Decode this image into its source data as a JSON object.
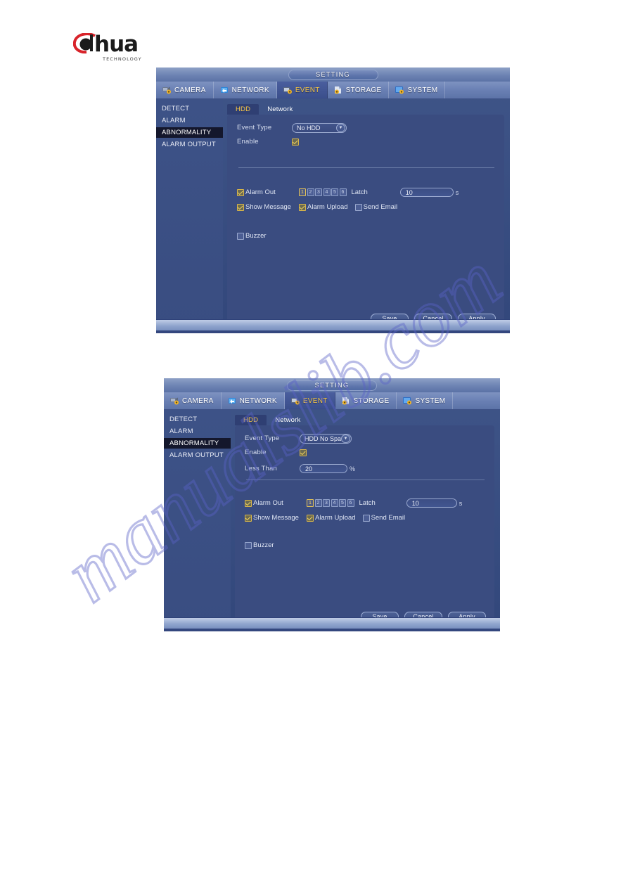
{
  "logo": {
    "brand": "a|hua",
    "brand_text": "hua",
    "sub": "TECHNOLOGY"
  },
  "watermark": {
    "text": "manualslib.com"
  },
  "dialogs": [
    {
      "title": "SETTING",
      "tabs": [
        {
          "label": "CAMERA",
          "icon": "camera-gear-icon",
          "active": false
        },
        {
          "label": "NETWORK",
          "icon": "network-icon",
          "active": false
        },
        {
          "label": "EVENT",
          "icon": "event-gear-icon",
          "active": true
        },
        {
          "label": "STORAGE",
          "icon": "storage-gear-icon",
          "active": false
        },
        {
          "label": "SYSTEM",
          "icon": "system-gear-icon",
          "active": false
        }
      ],
      "sidebar": [
        {
          "label": "DETECT",
          "active": false
        },
        {
          "label": "ALARM",
          "active": false
        },
        {
          "label": "ABNORMALITY",
          "active": true
        },
        {
          "label": "ALARM OUTPUT",
          "active": false
        }
      ],
      "subtabs": [
        {
          "label": "HDD",
          "active": true
        },
        {
          "label": "Network",
          "active": false
        }
      ],
      "form": {
        "event_type_label": "Event Type",
        "event_type_value": "No HDD",
        "enable_label": "Enable",
        "enable_checked": true,
        "less_than_label": "",
        "less_than_value": "",
        "less_than_unit": "",
        "show_less_than": false
      },
      "alarm": {
        "alarm_out_label": "Alarm Out",
        "alarm_out_checked": true,
        "channels": [
          "1",
          "2",
          "3",
          "4",
          "5",
          "6"
        ],
        "channel_selected": "1",
        "latch_label": "Latch",
        "latch_value": "10",
        "latch_unit": "s",
        "show_message_label": "Show Message",
        "show_message_checked": true,
        "alarm_upload_label": "Alarm Upload",
        "alarm_upload_checked": true,
        "send_email_label": "Send Email",
        "send_email_checked": false,
        "buzzer_label": "Buzzer",
        "buzzer_checked": false
      },
      "buttons": {
        "save": "Save",
        "cancel": "Cancel",
        "apply": "Apply"
      }
    },
    {
      "title": "SETTING",
      "tabs": [
        {
          "label": "CAMERA",
          "icon": "camera-gear-icon",
          "active": false
        },
        {
          "label": "NETWORK",
          "icon": "network-icon",
          "active": false
        },
        {
          "label": "EVENT",
          "icon": "event-gear-icon",
          "active": true
        },
        {
          "label": "STORAGE",
          "icon": "storage-gear-icon",
          "active": false
        },
        {
          "label": "SYSTEM",
          "icon": "system-gear-icon",
          "active": false
        }
      ],
      "sidebar": [
        {
          "label": "DETECT",
          "active": false
        },
        {
          "label": "ALARM",
          "active": false
        },
        {
          "label": "ABNORMALITY",
          "active": true
        },
        {
          "label": "ALARM OUTPUT",
          "active": false
        }
      ],
      "subtabs": [
        {
          "label": "HDD",
          "active": true
        },
        {
          "label": "Network",
          "active": false
        }
      ],
      "form": {
        "event_type_label": "Event Type",
        "event_type_value": "HDD No Spac",
        "enable_label": "Enable",
        "enable_checked": true,
        "less_than_label": "Less Than",
        "less_than_value": "20",
        "less_than_unit": "%",
        "show_less_than": true
      },
      "alarm": {
        "alarm_out_label": "Alarm Out",
        "alarm_out_checked": true,
        "channels": [
          "1",
          "2",
          "3",
          "4",
          "5",
          "6"
        ],
        "channel_selected": "1",
        "latch_label": "Latch",
        "latch_value": "10",
        "latch_unit": "s",
        "show_message_label": "Show Message",
        "show_message_checked": true,
        "alarm_upload_label": "Alarm Upload",
        "alarm_upload_checked": true,
        "send_email_label": "Send Email",
        "send_email_checked": false,
        "buzzer_label": "Buzzer",
        "buzzer_checked": false
      },
      "buttons": {
        "save": "Save",
        "cancel": "Cancel",
        "apply": "Apply"
      }
    }
  ]
}
